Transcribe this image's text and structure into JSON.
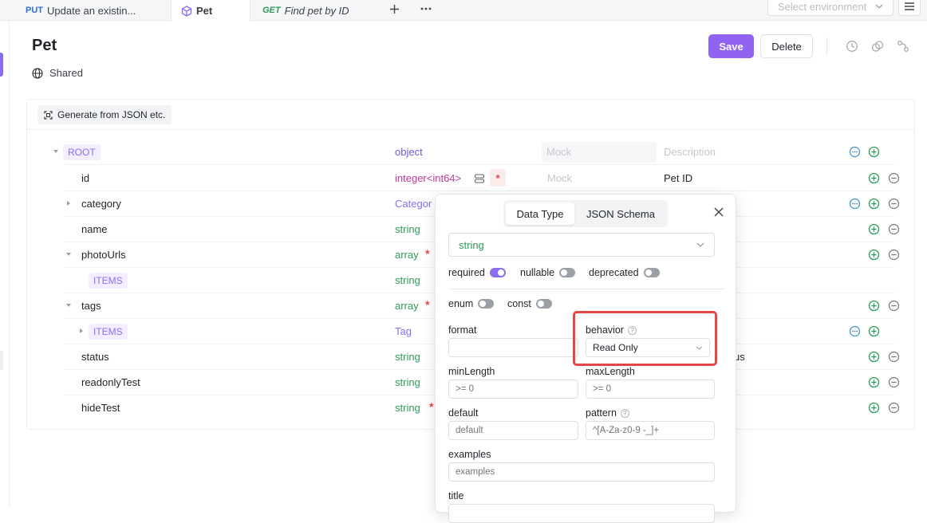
{
  "tabs": [
    {
      "method": "PUT",
      "label": "Update an existin..."
    },
    {
      "label": "Pet"
    },
    {
      "method": "GET",
      "label": "Find pet by ID"
    }
  ],
  "environment": {
    "placeholder": "Select environment"
  },
  "header": {
    "title": "Pet",
    "visibility": "Shared",
    "save_label": "Save",
    "delete_label": "Delete"
  },
  "toolbar": {
    "generate_label": "Generate from JSON etc."
  },
  "schema": {
    "mock_placeholder": "Mock",
    "description_placeholder": "Description",
    "rows": [
      {
        "name": "ROOT",
        "type": "object",
        "mock": "Mock",
        "description": "Description"
      },
      {
        "name": "id",
        "type": "integer<int64>",
        "mock": "Mock",
        "description": "Pet ID"
      },
      {
        "name": "category",
        "type": "Categor"
      },
      {
        "name": "name",
        "type": "string"
      },
      {
        "name": "photoUrls",
        "type": "array"
      },
      {
        "name": "ITEMS",
        "type": "string"
      },
      {
        "name": "tags",
        "type": "array"
      },
      {
        "name": "ITEMS",
        "type": "Tag"
      },
      {
        "name": "status",
        "type": "string",
        "description_fragment": "us"
      },
      {
        "name": "readonlyTest",
        "type": "string"
      },
      {
        "name": "hideTest",
        "type": "string"
      }
    ]
  },
  "popup": {
    "tabs": [
      "Data Type",
      "JSON Schema"
    ],
    "data_type_value": "string",
    "toggles1": [
      {
        "label": "required",
        "on": true
      },
      {
        "label": "nullable",
        "on": false
      },
      {
        "label": "deprecated",
        "on": false
      }
    ],
    "toggles2": [
      {
        "label": "enum",
        "on": false
      },
      {
        "label": "const",
        "on": false
      }
    ],
    "format_label": "format",
    "behavior_label": "behavior",
    "behavior_value": "Read Only",
    "minLength_label": "minLength",
    "minLength_placeholder": ">= 0",
    "maxLength_label": "maxLength",
    "maxLength_placeholder": ">= 0",
    "default_label": "default",
    "default_placeholder": "default",
    "pattern_label": "pattern",
    "pattern_placeholder": "^[A-Za-z0-9 -_]+",
    "examples_label": "examples",
    "examples_placeholder": "examples",
    "title_label": "title"
  },
  "colors": {
    "accent": "#9063f0",
    "highlight": "#e04848",
    "required": "#e5484d"
  }
}
